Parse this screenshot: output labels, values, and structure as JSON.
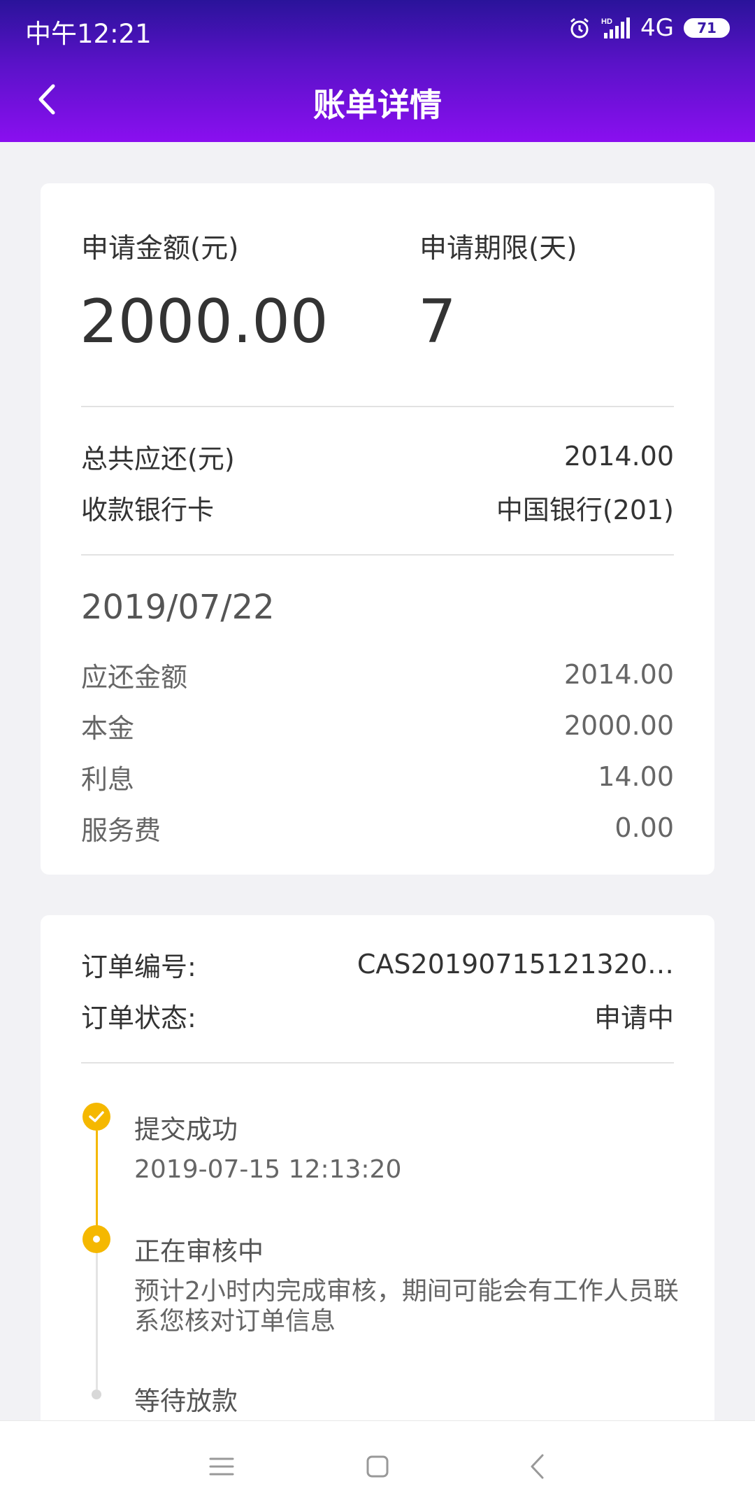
{
  "status_bar": {
    "time": "中午12:21",
    "network": "4G",
    "battery": "71",
    "icons": [
      "alarm-icon",
      "hd-signal-icon",
      "battery-icon"
    ]
  },
  "nav": {
    "title": "账单详情",
    "back_icon": "chevron-left-icon"
  },
  "summary": {
    "amount_label": "申请金额(元)",
    "amount_value": "2000.00",
    "term_label": "申请期限(天)",
    "term_value": "7",
    "total_label": "总共应还(元)",
    "total_value": "2014.00",
    "bank_label": "收款银行卡",
    "bank_value": "中国银行(201)"
  },
  "repayment": {
    "date": "2019/07/22",
    "items": [
      {
        "label": "应还金额",
        "value": "2014.00"
      },
      {
        "label": "本金",
        "value": "2000.00"
      },
      {
        "label": "利息",
        "value": "14.00"
      },
      {
        "label": "服务费",
        "value": "0.00"
      }
    ]
  },
  "order": {
    "number_label": "订单编号:",
    "number_value": "CAS20190715121320…",
    "status_label": "订单状态:",
    "status_value": "申请中"
  },
  "timeline": [
    {
      "title": "提交成功",
      "detail": "2019-07-15 12:13:20",
      "state": "done"
    },
    {
      "title": "正在审核中",
      "detail": "预计2小时内完成审核，期间可能会有工作人员联系您核对订单信息",
      "state": "active"
    },
    {
      "title": "等待放款",
      "detail": "",
      "state": "pending"
    }
  ],
  "colors": {
    "header_top": "#2a139a",
    "header_bottom": "#8a0ff0",
    "accent": "#f5b800",
    "background": "#f2f2f5"
  },
  "system_nav": [
    "menu-icon",
    "home-icon",
    "back-icon"
  ]
}
